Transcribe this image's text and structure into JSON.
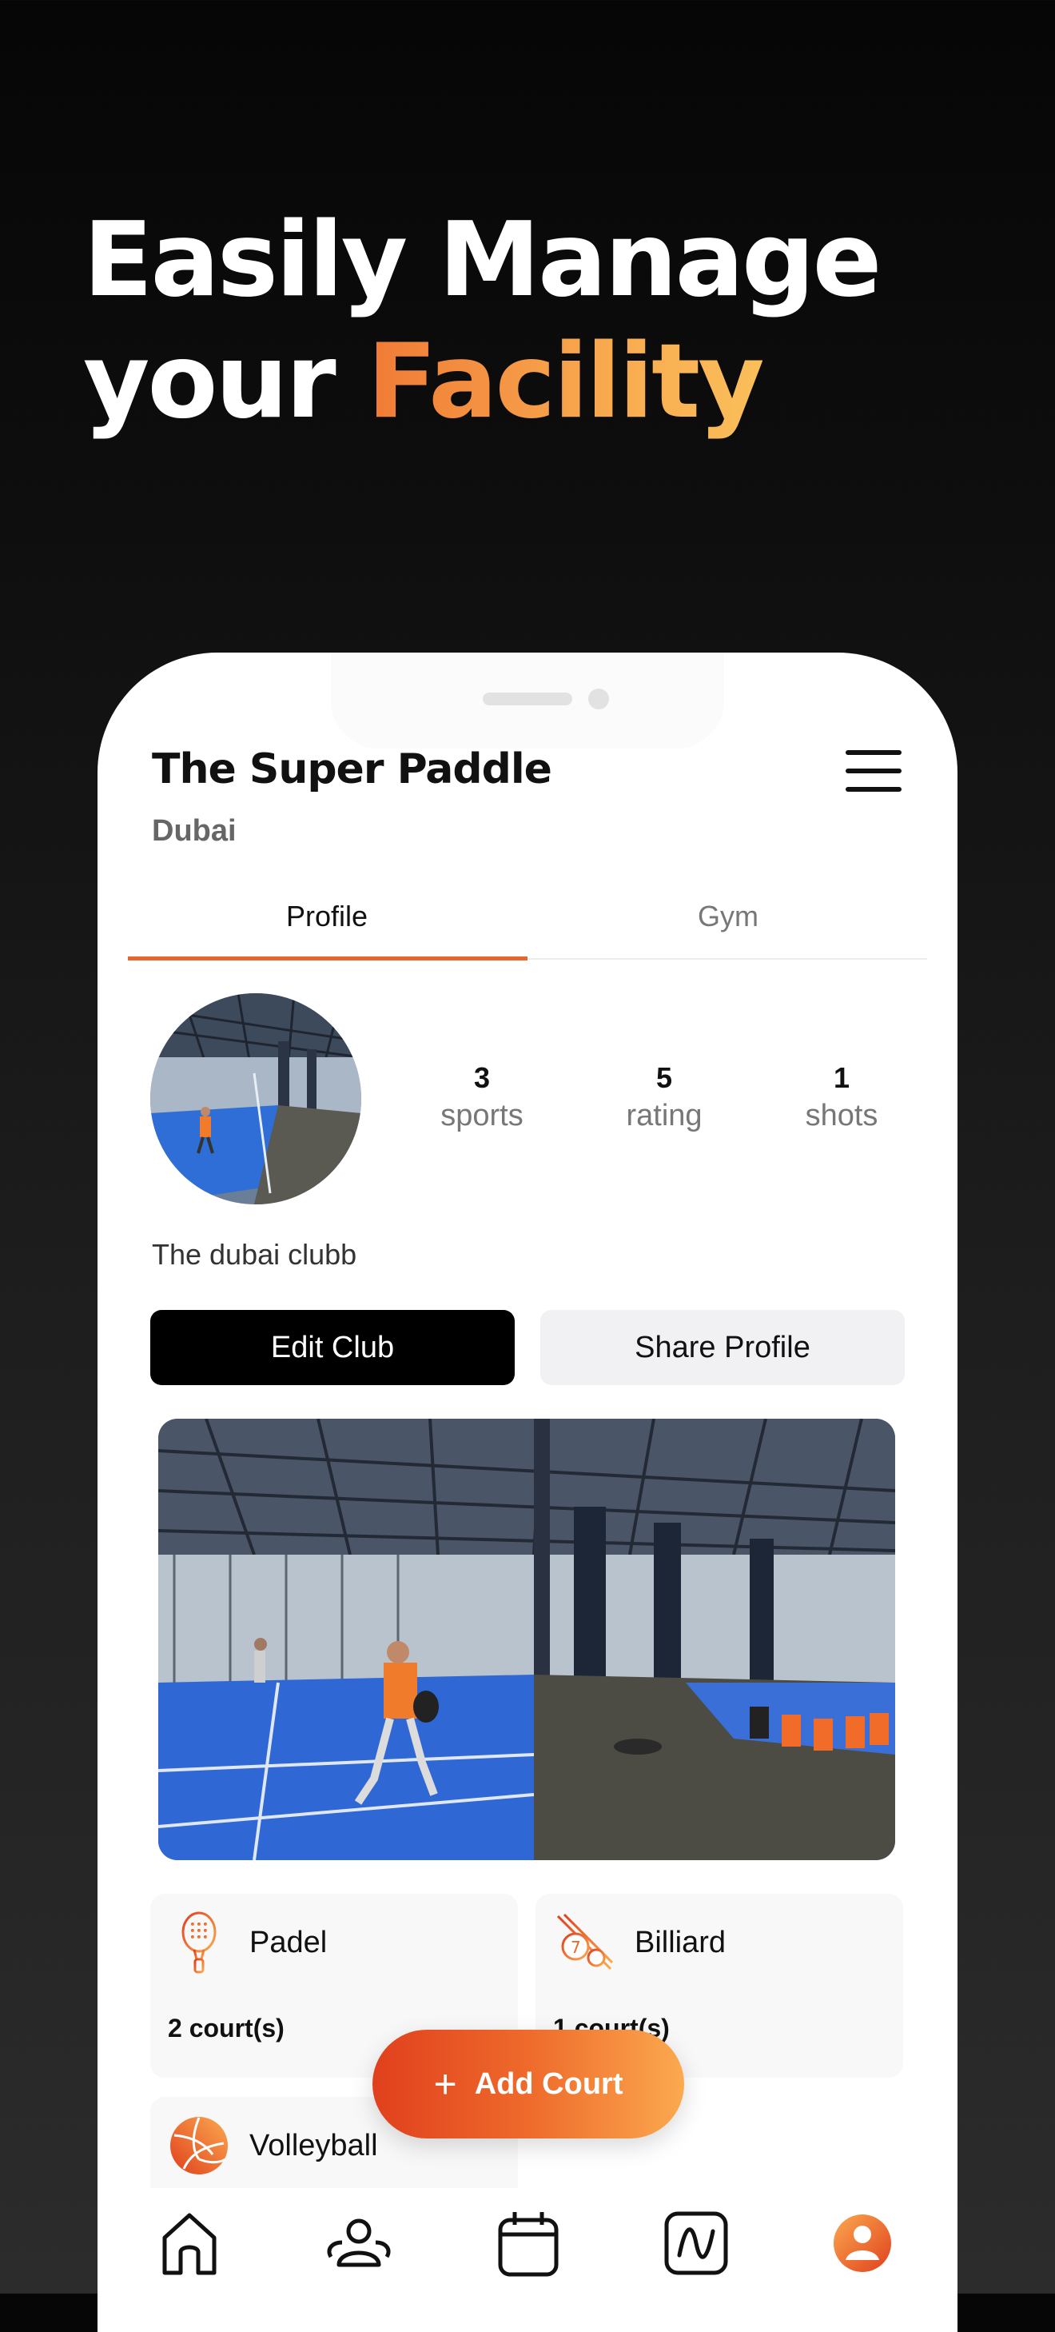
{
  "headline": {
    "line1": "Easily Manage",
    "line2_prefix": "your ",
    "line2_accent": "Facility"
  },
  "club": {
    "name": "The Super Paddle",
    "city": "Dubai",
    "bio": "The dubai clubb"
  },
  "tabs": [
    {
      "label": "Profile",
      "active": true
    },
    {
      "label": "Gym",
      "active": false
    }
  ],
  "stats": [
    {
      "value": "3",
      "label": "sports"
    },
    {
      "value": "5",
      "label": "rating"
    },
    {
      "value": "1",
      "label": "shots"
    }
  ],
  "actions": {
    "edit_label": "Edit Club",
    "share_label": "Share Profile"
  },
  "sports": [
    {
      "name": "Padel",
      "count": "2 court(s)",
      "icon": "padel-racket-icon"
    },
    {
      "name": "Billiard",
      "count": "1 court(s)",
      "icon": "billiard-icon"
    },
    {
      "name": "Volleyball",
      "count": "",
      "icon": "volleyball-icon"
    }
  ],
  "add_court": {
    "label": "Add Court",
    "icon": "plus-icon"
  },
  "bottom_nav": [
    "home-icon",
    "community-icon",
    "calendar-icon",
    "activity-icon",
    "profile-icon"
  ],
  "colors": {
    "accent": "#e5672f",
    "accent_light": "#fba94f",
    "dark": "#000000"
  }
}
